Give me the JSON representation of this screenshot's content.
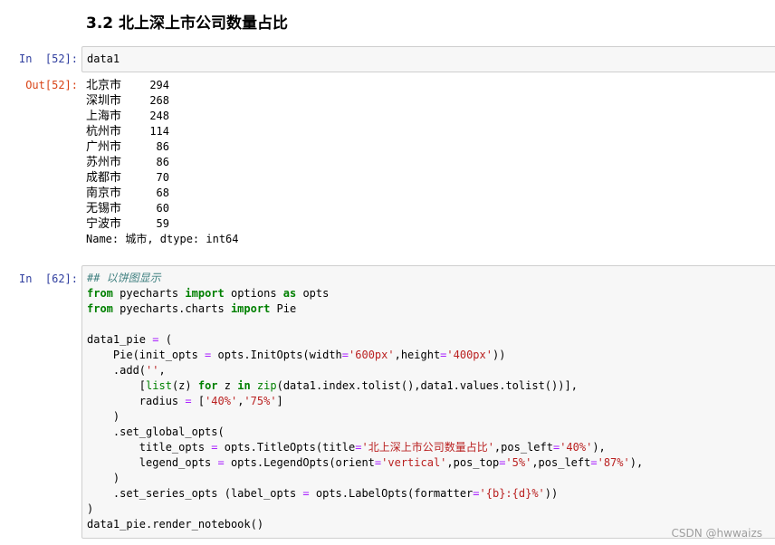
{
  "heading": "3.2 北上深上市公司数量占比",
  "cells": [
    {
      "in_prompt": "In  [52]:",
      "code": "data1",
      "out_prompt": "Out[52]:",
      "output": {
        "rows": [
          {
            "city": "北京市",
            "count": "294"
          },
          {
            "city": "深圳市",
            "count": "268"
          },
          {
            "city": "上海市",
            "count": "248"
          },
          {
            "city": "杭州市",
            "count": "114"
          },
          {
            "city": "广州市",
            "count": "86"
          },
          {
            "city": "苏州市",
            "count": "86"
          },
          {
            "city": "成都市",
            "count": "70"
          },
          {
            "city": "南京市",
            "count": "68"
          },
          {
            "city": "无锡市",
            "count": "60"
          },
          {
            "city": "宁波市",
            "count": "59"
          }
        ],
        "footer": "Name: 城市, dtype: int64"
      }
    },
    {
      "in_prompt": "In  [62]:",
      "code_lines": [
        "## 以饼图显示",
        "from pyecharts import options as opts",
        "from pyecharts.charts import Pie",
        "",
        "data1_pie = (",
        "    Pie(init_opts = opts.InitOpts(width='600px',height='400px'))",
        "    .add('',",
        "        [list(z) for z in zip(data1.index.tolist(),data1.values.tolist())],",
        "        radius = ['40%','75%']",
        "    )",
        "    .set_global_opts(",
        "        title_opts = opts.TitleOpts(title='北上深上市公司数量占比',pos_left='40%'),",
        "        legend_opts = opts.LegendOpts(orient='vertical',pos_top='5%',pos_left='87%'),",
        "    )",
        "    .set_series_opts (label_opts = opts.LabelOpts(formatter='{b}:{d}%'))",
        ")",
        "data1_pie.render_notebook()"
      ]
    }
  ],
  "watermark": "CSDN @hwwaizs"
}
